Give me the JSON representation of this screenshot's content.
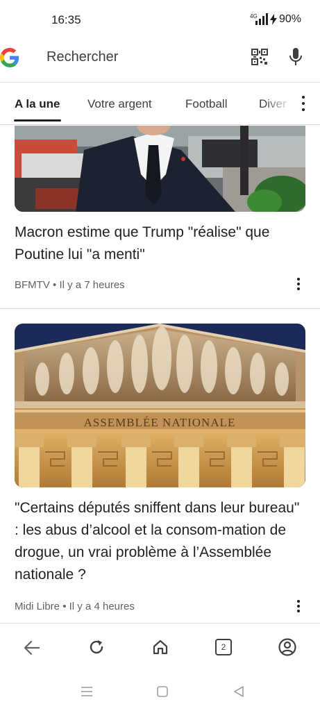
{
  "status_bar": {
    "time": "16:35",
    "network": "4G",
    "battery": "90%"
  },
  "search": {
    "placeholder": "Rechercher"
  },
  "tabs": [
    {
      "label": "A la une",
      "active": true
    },
    {
      "label": "Votre argent",
      "active": false
    },
    {
      "label": "Football",
      "active": false
    },
    {
      "label": "Diver",
      "active": false
    }
  ],
  "articles": [
    {
      "title": "Macron estime que Trump \"réalise\" que Poutine lui \"a menti\"",
      "source": "BFMTV",
      "time": "Il y a 7 heures"
    },
    {
      "title": "\"Certains députés sniffent dans leur bureau\" : les abus d’alcool et la consom-mation de drogue, un vrai problème à l’Assemblée nationale ?",
      "source": "Midi Libre",
      "time": "Il y a 4 heures",
      "image_text": "ASSEMBLÉE NATIONALE"
    }
  ],
  "bottom_bar": {
    "tab_count": "2"
  },
  "colors": {
    "google_blue": "#4285F4",
    "google_red": "#EA4335",
    "google_yellow": "#FBBC05",
    "google_green": "#34A853",
    "text": "#202124",
    "muted": "#5f6368"
  },
  "icons": [
    "qr-code-icon",
    "microphone-icon",
    "back-arrow-icon",
    "reload-icon",
    "home-icon",
    "account-icon",
    "recents-icon",
    "overview-icon",
    "nav-back-icon"
  ]
}
